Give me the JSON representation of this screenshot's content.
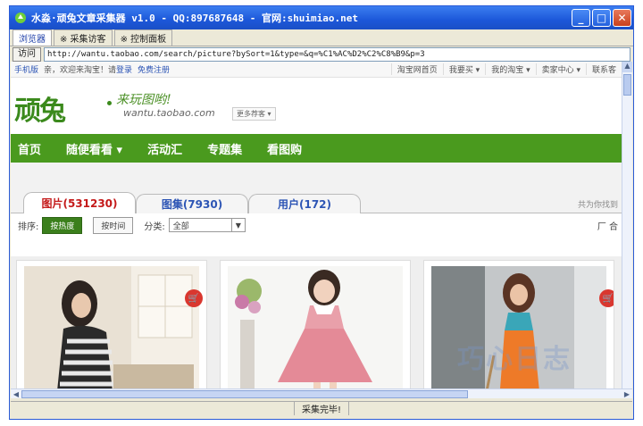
{
  "window": {
    "title": "水淼·顽兔文章采集器 v1.0 - QQ:897687648 - 官网:shuimiao.net",
    "minimize_glyph": "_",
    "maximize_glyph": "□",
    "close_glyph": "✕"
  },
  "tabs": [
    "浏览器",
    "※ 采集访客",
    "※ 控制面板"
  ],
  "address": {
    "go_label": "访问",
    "url": "http://wantu.taobao.com/search/picture?bySort=1&type=&q=%C1%AC%D2%C2%C8%B9&p=3"
  },
  "topnav": {
    "mobile": "手机版",
    "greeting": "亲，欢迎来淘宝！请",
    "login": "登录",
    "register": "免费注册",
    "links": [
      "淘宝网首页",
      "我要买 ▾",
      "我的淘宝 ▾",
      "卖家中心 ▾",
      "联系客"
    ]
  },
  "logo": {
    "main": "顽兔",
    "slogan": "来玩图哟!",
    "site": "wantu.taobao.com",
    "more": "更多荐客 ▾"
  },
  "greennav": [
    "首页",
    "随便看看 ▾",
    "活动汇",
    "专题集",
    "看图购"
  ],
  "ptabs": [
    {
      "label": "图片(531230)",
      "active": true
    },
    {
      "label": "图集(7930)",
      "active": false
    },
    {
      "label": "用户(172)",
      "active": false
    }
  ],
  "ptab_hint": "共为你找到",
  "filter": {
    "sort_label": "排序:",
    "by_hot": "按热度",
    "by_time": "按时间",
    "category_label": "分类:",
    "category_value": "全部",
    "right_text": "厂 合"
  },
  "cards": [
    {
      "alt": "striped-dress-model",
      "cart": true
    },
    {
      "alt": "pink-dress-girl",
      "cart": false
    },
    {
      "alt": "orange-dress-model",
      "cart": true
    }
  ],
  "status": "采集完毕!",
  "watermark": "巧心日志",
  "colors": {
    "green_nav": "#4a9a1e",
    "active_tab_text": "#c41a1a",
    "tab_text": "#2d55b5",
    "titlebar": "#1c57d9"
  }
}
